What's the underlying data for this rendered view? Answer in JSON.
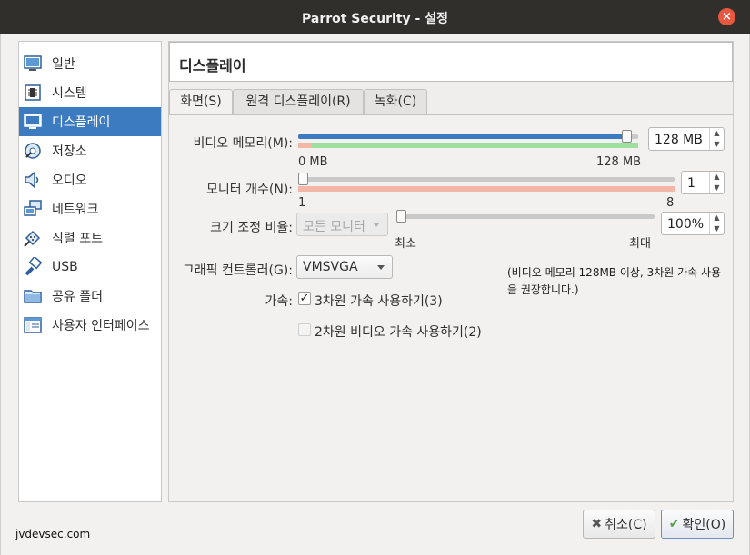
{
  "window": {
    "title": "Parrot Security - 설정",
    "close_label": "×"
  },
  "sidebar": {
    "items": [
      {
        "label": "일반"
      },
      {
        "label": "시스템"
      },
      {
        "label": "디스플레이"
      },
      {
        "label": "저장소"
      },
      {
        "label": "오디오"
      },
      {
        "label": "네트워크"
      },
      {
        "label": "직렬 포트"
      },
      {
        "label": "USB"
      },
      {
        "label": "공유 폴더"
      },
      {
        "label": "사용자 인터페이스"
      }
    ]
  },
  "page": {
    "title": "디스플레이",
    "tabs": [
      {
        "label": "화면(S)"
      },
      {
        "label": "원격 디스플레이(R)"
      },
      {
        "label": "녹화(C)"
      }
    ]
  },
  "screen": {
    "video_memory": {
      "label": "비디오 메모리(M):",
      "value": "128 MB",
      "level": 0.98,
      "min_label": "0 MB",
      "max_label": "128 MB"
    },
    "monitor_count": {
      "label": "모니터 개수(N):",
      "value": "1",
      "level": 0.0,
      "min_label": "1",
      "max_label": "8"
    },
    "scale_factor": {
      "label": "크기 조정 비율:",
      "combo_value": "모든 모니터",
      "value": "100%",
      "level": 0.0,
      "min_label": "최소",
      "max_label": "최대"
    },
    "graphics_controller": {
      "label": "그래픽 컨트롤러(G):",
      "value": "VMSVGA"
    },
    "acceleration": {
      "label": "가속:",
      "accel_3d": {
        "label": "3차원 가속 사용하기(3)",
        "checked": true
      },
      "accel_2d": {
        "label": "2차원 비디오 가속 사용하기(2)",
        "checked": false
      }
    },
    "note": "(비디오 메모리 128MB 이상, 3차원 가속 사용을 권장합니다.)"
  },
  "footer": {
    "watermark": "jvdevsec.com",
    "cancel_label": "취소(C)",
    "ok_label": "확인(O)"
  },
  "colors": {
    "accent": "#3c7bc0",
    "titlebar": "#302f2c",
    "close": "#e9573f",
    "zone_green": "#9fe09f",
    "zone_red": "#f3b7a7"
  },
  "icons": [
    "general-icon",
    "system-icon",
    "display-icon",
    "storage-icon",
    "audio-icon",
    "network-icon",
    "serial-port-icon",
    "usb-icon",
    "shared-folder-icon",
    "user-interface-icon",
    "cancel-x-icon",
    "ok-check-icon"
  ]
}
